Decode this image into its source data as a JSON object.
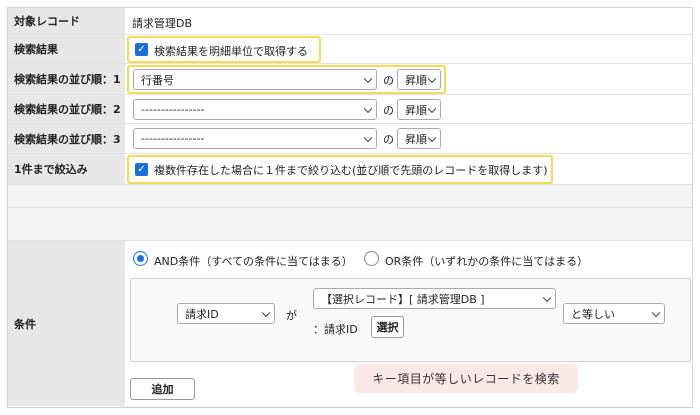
{
  "rows": {
    "target": {
      "label": "対象レコード",
      "value": "請求管理DB"
    },
    "search_result": {
      "label": "検索結果",
      "checkbox_text": "検索結果を明細単位で取得する",
      "checked": true
    },
    "sort1": {
      "label": "検索結果の並び順：1",
      "field": "行番号",
      "connector": "の",
      "order": "昇順"
    },
    "sort2": {
      "label": "検索結果の並び順：2",
      "field": "----------------",
      "connector": "の",
      "order": "昇順"
    },
    "sort3": {
      "label": "検索結果の並び順：3",
      "field": "----------------",
      "connector": "の",
      "order": "昇順"
    },
    "narrow": {
      "label": "1件まで絞込み",
      "checkbox_text": "複数件存在した場合に１件まで絞り込む(並び順で先頭のレコードを取得します)",
      "checked": true
    }
  },
  "conditions": {
    "label": "条件",
    "and_option": "AND条件（すべての条件に当てはまる）",
    "or_option": "OR条件（いずれかの条件に当てはまる）",
    "selected": "AND",
    "left_field": "請求ID",
    "particle": "が",
    "right_field": "【選択レコード】[ 請求管理DB ]",
    "right_sub": "：請求ID",
    "select_button": "選択",
    "operator": "と等しい",
    "add_button": "追加"
  },
  "tooltip": "キー項目が等しいレコードを検索",
  "colors": {
    "highlight": "#f2dc55",
    "accent": "#1a6fd6",
    "tooltip_bg": "#fde8e8"
  }
}
